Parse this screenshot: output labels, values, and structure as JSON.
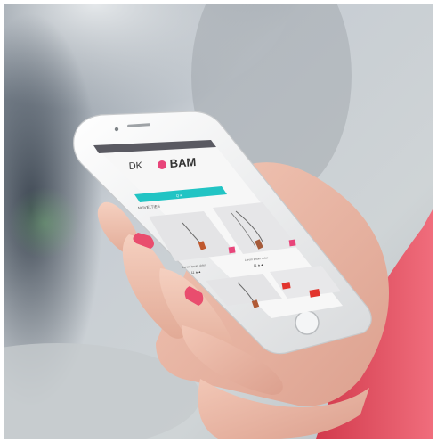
{
  "scene": {
    "description_visible": false
  },
  "phone_screen": {
    "logo": {
      "left_part": "DK",
      "right_part": "BAM"
    },
    "search_bar": {
      "label": "Q  ≡"
    },
    "section_title": "NOVELTIES",
    "products": [
      {
        "name": "Lorem ipsum dolor",
        "price": "11 ▲▲"
      },
      {
        "name": "Lorem ipsum dolor",
        "price": "11 ▲▲"
      }
    ],
    "colors": {
      "accent_teal": "#22c4c4",
      "accent_pink": "#e8457a",
      "logo_pink": "#e8457a",
      "topbar_gray": "#5a5a62"
    }
  }
}
